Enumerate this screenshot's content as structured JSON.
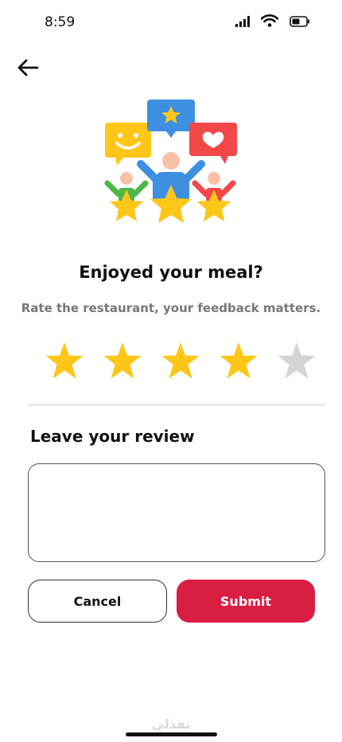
{
  "status_bar": {
    "time": "8:59",
    "icons": [
      "cellular-signal-icon",
      "wifi-icon",
      "battery-icon"
    ]
  },
  "nav": {
    "back_icon": "arrow-left-icon"
  },
  "hero": {
    "illustration": "feedback-people-stars-illustration"
  },
  "heading": {
    "title": "Enjoyed your meal?",
    "subtitle": "Rate the restaurant, your feedback matters."
  },
  "rating": {
    "value": 4,
    "max": 5,
    "filled_color": "#FFC61A",
    "empty_color": "#D4D4D4"
  },
  "review": {
    "heading": "Leave your review",
    "value": "",
    "placeholder": ""
  },
  "actions": {
    "cancel_label": "Cancel",
    "submit_label": "Submit"
  },
  "colors": {
    "accent": "#D91E44"
  },
  "watermark": {
    "text": "نفذلي"
  }
}
